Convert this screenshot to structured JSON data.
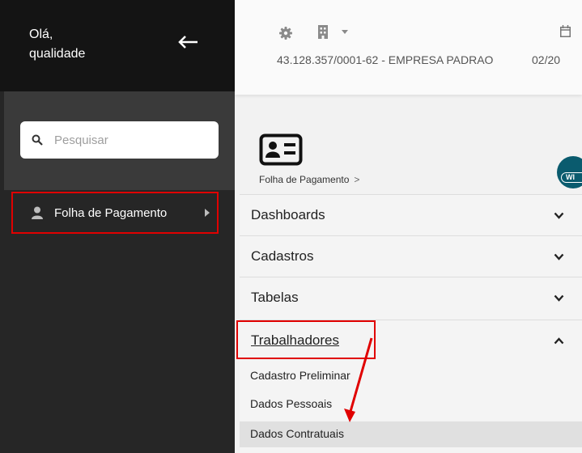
{
  "sidebar": {
    "greeting_line1": "Olá,",
    "greeting_line2": "qualidade",
    "search_placeholder": "Pesquisar",
    "nav_items": [
      {
        "label": "Folha de Pagamento",
        "icon": "person-icon"
      }
    ]
  },
  "header": {
    "company": "43.128.357/0001-62 - EMPRESA PADRAO",
    "date": "02/20"
  },
  "module": {
    "breadcrumb": "Folha de Pagamento",
    "breadcrumb_sep": ">",
    "badge": "WI"
  },
  "menu": {
    "sections": [
      {
        "label": "Dashboards",
        "state": "collapsed"
      },
      {
        "label": "Cadastros",
        "state": "collapsed"
      },
      {
        "label": "Tabelas",
        "state": "collapsed"
      },
      {
        "label": "Trabalhadores",
        "state": "expanded"
      }
    ],
    "subitems": [
      {
        "label": "Cadastro Preliminar"
      },
      {
        "label": "Dados Pessoais"
      },
      {
        "label": "Dados Contratuais",
        "highlighted": true
      }
    ]
  },
  "colors": {
    "sidebar_bg": "#262626",
    "sidebar_top_bg": "#141414",
    "annotation_red": "#e00000",
    "badge_bg": "#0a5b6e"
  }
}
